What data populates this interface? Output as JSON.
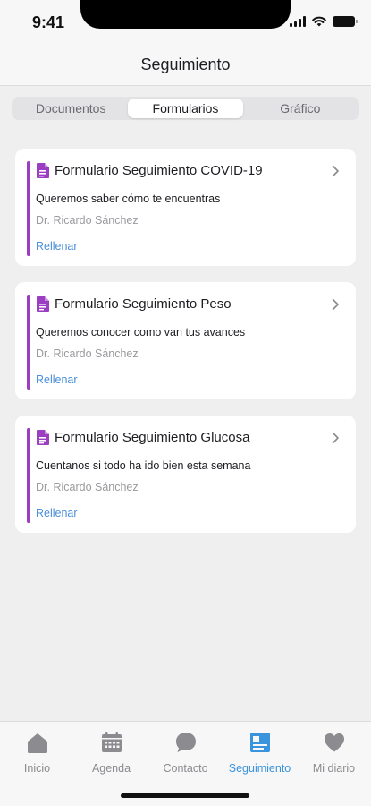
{
  "status": {
    "time": "9:41"
  },
  "header": {
    "title": "Seguimiento"
  },
  "segments": [
    {
      "label": "Documentos",
      "active": false
    },
    {
      "label": "Formularios",
      "active": true
    },
    {
      "label": "Gráfico",
      "active": false
    }
  ],
  "cards": [
    {
      "title": "Formulario Seguimiento COVID-19",
      "subtitle": "Queremos saber cómo te encuentras",
      "author": "Dr. Ricardo Sánchez",
      "action": "Rellenar"
    },
    {
      "title": "Formulario Seguimiento Peso",
      "subtitle": "Queremos conocer como van tus avances",
      "author": "Dr. Ricardo Sánchez",
      "action": "Rellenar"
    },
    {
      "title": "Formulario Seguimiento Glucosa",
      "subtitle": "Cuentanos si todo ha ido bien esta semana",
      "author": "Dr. Ricardo Sánchez",
      "action": "Rellenar"
    }
  ],
  "tabs": [
    {
      "label": "Inicio",
      "icon": "home-icon",
      "active": false
    },
    {
      "label": "Agenda",
      "icon": "calendar-icon",
      "active": false
    },
    {
      "label": "Contacto",
      "icon": "chat-bubble-icon",
      "active": false
    },
    {
      "label": "Seguimiento",
      "icon": "document-card-icon",
      "active": true
    },
    {
      "label": "Mi diario",
      "icon": "heart-icon",
      "active": false
    }
  ],
  "colors": {
    "accent": "#9b3ec1",
    "link": "#4a8fdb",
    "active_tab": "#3a93dd",
    "inactive_tab": "#8b8b90"
  }
}
